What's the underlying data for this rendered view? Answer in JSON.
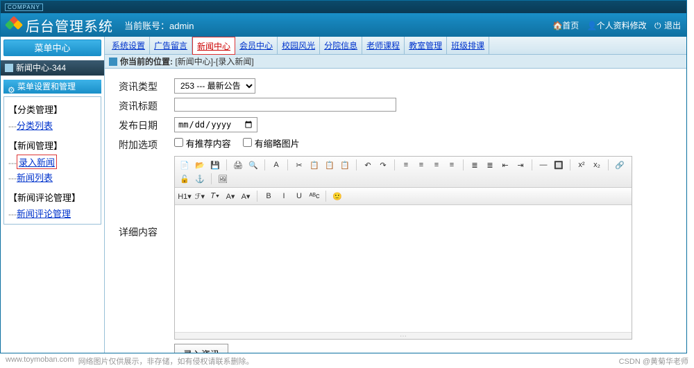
{
  "topbar": {
    "company": "COMPANY"
  },
  "header": {
    "title": "后台管理系统",
    "account_label": "当前账号：",
    "account_value": "admin",
    "links": {
      "home": "首页",
      "profile": "个人资料修改",
      "logout": "退出"
    }
  },
  "sidebar": {
    "menu_center": "菜单中心",
    "news_center": "新闻中心-344",
    "subhead": "菜单设置和管理",
    "groups": [
      {
        "title": "【分类管理】",
        "items": [
          {
            "label": "分类列表",
            "active": false
          }
        ]
      },
      {
        "title": "【新闻管理】",
        "items": [
          {
            "label": "录入新闻",
            "active": true
          },
          {
            "label": "新闻列表",
            "active": false
          }
        ]
      },
      {
        "title": "【新闻评论管理】",
        "items": [
          {
            "label": "新闻评论管理",
            "active": false
          }
        ]
      }
    ]
  },
  "tabs": [
    {
      "label": "系统设置",
      "active": false
    },
    {
      "label": "广告留言",
      "active": false
    },
    {
      "label": "新闻中心",
      "active": true
    },
    {
      "label": "会员中心",
      "active": false
    },
    {
      "label": "校园风光",
      "active": false
    },
    {
      "label": "分院信息",
      "active": false
    },
    {
      "label": "老师课程",
      "active": false
    },
    {
      "label": "教室管理",
      "active": false
    },
    {
      "label": "班级排课",
      "active": false
    }
  ],
  "breadcrumb": {
    "prefix": "你当前的位置:",
    "path": "[新闻中心]-[录入新闻]"
  },
  "form": {
    "type_label": "资讯类型",
    "type_value": "253 --- 最新公告",
    "title_label": "资讯标题",
    "title_value": "",
    "date_label": "发布日期",
    "date_placeholder": "年 /月/日",
    "extra_label": "附加选项",
    "checkbox_recommend": "有推荐内容",
    "checkbox_thumb": "有缩略图片",
    "content_label": "详细内容",
    "submit": "录入资讯"
  },
  "editor_toolbar_row1": [
    "📄",
    "📂",
    "💾",
    "|",
    "🖨",
    "🔍",
    "|",
    "A",
    "|",
    "✂",
    "📋",
    "📋",
    "📋",
    "|",
    "↶",
    "↷",
    "|",
    "≡",
    "≡",
    "≡",
    "≡",
    "|",
    "≣",
    "≣",
    "⇤",
    "⇥",
    "|",
    "—",
    "🔲",
    "|",
    "x²",
    "x₂",
    "|",
    "🔗",
    "🔓",
    "⚓",
    "|",
    "🖼"
  ],
  "editor_toolbar_row2": [
    "H1▾",
    "ℱ▾",
    "𝑇▾",
    "A▾",
    "A▾",
    "|",
    "B",
    "I",
    "U",
    "ᴬᴮᴄ",
    "|",
    "🙂"
  ],
  "footer": {
    "left_url": "www.toymoban.com",
    "left_note": "网络图片仅供展示，非存储，如有侵权请联系删除。",
    "right": "CSDN @黄菊华老师"
  }
}
